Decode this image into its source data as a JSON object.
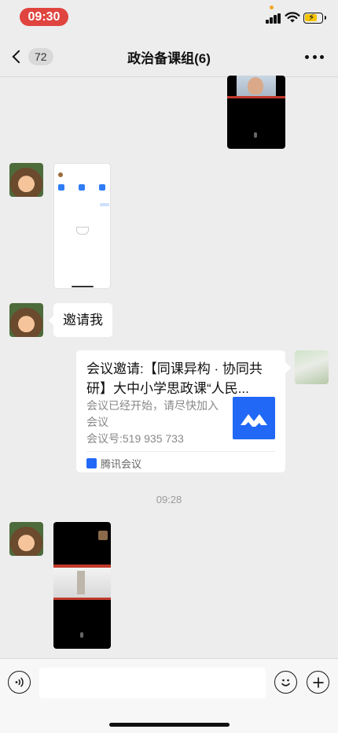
{
  "status_bar": {
    "time": "09:30"
  },
  "nav": {
    "unread_count": "72",
    "title": "政治备课组(6)"
  },
  "messages": {
    "invite_text": "邀请我",
    "meeting_card": {
      "title": "会议邀请:【同课异构 · 协同共研】大中小学思政课“人民...",
      "desc_line1": "会议已经开始，请尽快加入会议",
      "meeting_id": "会议号:519 935 733",
      "source_app": "腾讯会议"
    },
    "timestamp": "09:28"
  },
  "colors": {
    "accent_blue": "#2168f6",
    "time_pill": "#e0443e",
    "background": "#ededed"
  }
}
